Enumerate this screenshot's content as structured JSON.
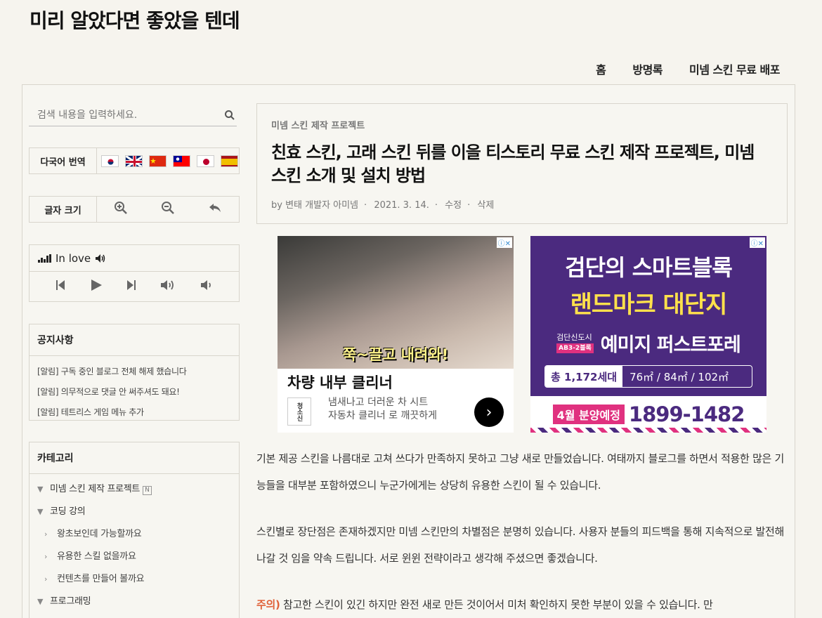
{
  "site": {
    "title": "미리 알았다면 좋았을 텐데"
  },
  "nav": [
    "홈",
    "방명록",
    "미넴 스킨 무료 배포"
  ],
  "search": {
    "placeholder": "검색 내용을 입력하세요."
  },
  "translate": {
    "label": "다국어 번역",
    "flags": [
      "korea-flag-icon",
      "uk-flag-icon",
      "china-flag-icon",
      "taiwan-flag-icon",
      "japan-flag-icon",
      "spain-flag-icon"
    ]
  },
  "fontsize": {
    "label": "글자 크기"
  },
  "player": {
    "track": "In love"
  },
  "notice": {
    "title": "공지사항",
    "items": [
      "[알림] 구독 중인 블로그 전체 해제 했습니다",
      "[알림] 의무적으로 댓글 안 써주셔도 돼요!",
      "[알림] 테트리스 게임 메뉴 추가"
    ]
  },
  "category": {
    "title": "카테고리",
    "items": [
      {
        "label": "미넴 스킨 제작 프로젝트",
        "badge": "N",
        "level": 1
      },
      {
        "label": "코딩 강의",
        "level": 1
      },
      {
        "label": "왕초보인데 가능할까요",
        "level": 2
      },
      {
        "label": "유용한 스킬 없을까요",
        "level": 2
      },
      {
        "label": "컨텐츠를 만들어 볼까요",
        "level": 2
      },
      {
        "label": "프로그래밍",
        "level": 1
      }
    ]
  },
  "post": {
    "category": "미넴 스킨 제작 프로젝트",
    "title": "친효 스킨, 고래 스킨 뒤를 이을 티스토리 무료 스킨 제작 프로젝트, 미넴 스킨 소개 및 설치 방법",
    "author": "by 변태 개발자 아미넴",
    "date": "2021. 3. 14.",
    "edit": "수정",
    "delete": "삭제"
  },
  "ad1": {
    "caption": "쭉~끌고 내려와!",
    "headline": "차량 내부 클리너",
    "brand": "청소신",
    "sub_line1": "냄새나고 더러운 차 시트",
    "sub_line2": "자동차 클리너 로 깨끗하게"
  },
  "ad2": {
    "line1": "검단의 스마트블록",
    "line2": "랜드마크 대단지",
    "small_line1": "검단신도시",
    "small_tag": "AB3-2블록",
    "brand": "예미지 퍼스트포레",
    "units": "총 1,172세대",
    "sizes": "76㎡ / 84㎡ / 102㎡",
    "tag": "4월 분양예정",
    "phone": "1899-1482"
  },
  "content": {
    "p1": "기본 제공 스킨을 나름대로 고쳐 쓰다가 만족하지 못하고 그냥 새로 만들었습니다. 여태까지 블로그를 하면서 적용한 많은 기능들을 대부분 포함하였으니 누군가에게는 상당히 유용한 스킨이 될 수 있습니다.",
    "p2": "스킨별로 장단점은 존재하겠지만 미넴 스킨만의 차별점은 분명히 있습니다. 사용자 분들의 피드백을 통해 지속적으로 발전해 나갈 것 임을 약속 드립니다. 서로 윈윈 전략이라고 생각해 주셨으면 좋겠습니다.",
    "warn_label": "주의)",
    "p3": "참고한 스킨이 있긴 하지만 완전 새로 만든 것이어서 미처 확인하지 못한 부분이 있을 수 있습니다. 만"
  }
}
